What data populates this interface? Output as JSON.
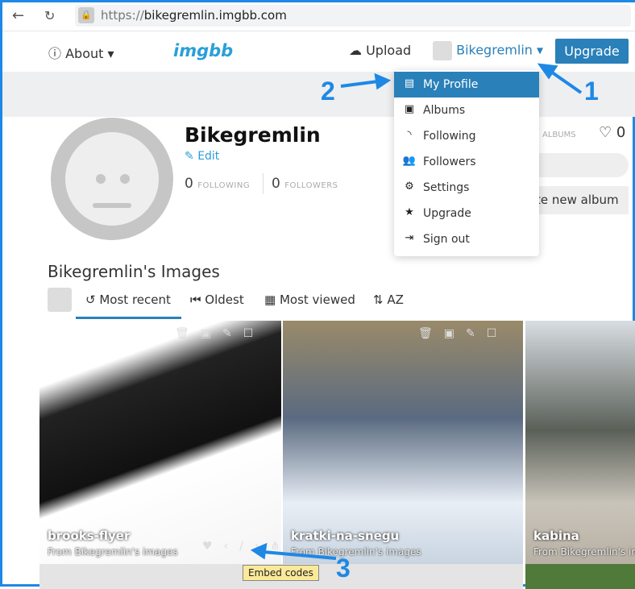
{
  "browser": {
    "url_protocol": "https://",
    "url_host": "bikegremlin.imgbb.com"
  },
  "nav": {
    "about": "About",
    "logo": "imgbb",
    "upload": "Upload",
    "user": "Bikegremlin",
    "upgrade": "Upgrade"
  },
  "profile": {
    "name": "Bikegremlin",
    "edit": "Edit",
    "following_count": "0",
    "following_label": "FOLLOWING",
    "followers_count": "0",
    "followers_label": "FOLLOWERS",
    "albums_label": "ALBUMS",
    "likes": "0",
    "create_album": "te new album"
  },
  "dropdown": {
    "items": [
      {
        "label": "My Profile",
        "icon": "id-card-icon"
      },
      {
        "label": "Albums",
        "icon": "images-icon"
      },
      {
        "label": "Following",
        "icon": "rss-icon"
      },
      {
        "label": "Followers",
        "icon": "users-icon"
      },
      {
        "label": "Settings",
        "icon": "user-cog-icon"
      },
      {
        "label": "Upgrade",
        "icon": "star-icon"
      },
      {
        "label": "Sign out",
        "icon": "sign-out-icon"
      }
    ]
  },
  "images": {
    "title": "Bikegremlin's Images",
    "tabs": [
      "Most recent",
      "Oldest",
      "Most viewed",
      "AZ"
    ],
    "items": [
      {
        "title": "brooks-flyer",
        "source": "From Bikegremlin's images"
      },
      {
        "title": "kratki-na-snegu",
        "source": "From Bikegremlin's images"
      },
      {
        "title": "kabina",
        "source": "From Bikegremlin's im"
      }
    ]
  },
  "tooltip": "Embed codes",
  "annotations": [
    "1",
    "2",
    "3"
  ],
  "colors": {
    "accent": "#2a80b9",
    "logo": "#2a9fd8",
    "annotation": "#1e88e5"
  }
}
